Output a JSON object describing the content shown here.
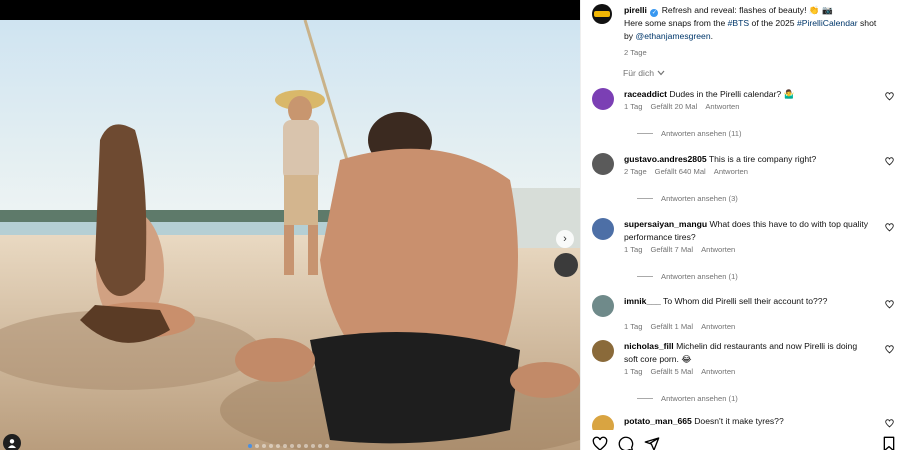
{
  "post": {
    "username": "pirelli",
    "caption_line1": "Refresh and reveal: flashes of beauty! 👏 📷",
    "caption_line2_prefix": "Here some snaps from the ",
    "caption_tag1": "#BTS",
    "caption_mid": " of the 2025 ",
    "caption_tag2": "#PirelliCalendar",
    "caption_suffix": " shot",
    "caption_line3_prefix": "by ",
    "caption_mention": "@ethanjamesgreen",
    "caption_end": ".",
    "time": "2 Tage"
  },
  "sort_label": "Für dich",
  "comments": [
    {
      "username": "raceaddict",
      "text": "Dudes in the Pirelli calendar? 🤷‍♂️",
      "time": "1 Tag",
      "likes": "Gefällt 20 Mal",
      "reply": "Antworten",
      "replies": "Antworten ansehen (11)",
      "avatar_color": "#7b3fb4"
    },
    {
      "username": "gustavo.andres2805",
      "text": "This is a tire company right?",
      "time": "2 Tage",
      "likes": "Gefällt 640 Mal",
      "reply": "Antworten",
      "replies": "Antworten ansehen (3)",
      "avatar_color": "#5a5a5a"
    },
    {
      "username": "supersaiyan_mangu",
      "text": "What does this have to do with top quality performance tires?",
      "time": "1 Tag",
      "likes": "Gefällt 7 Mal",
      "reply": "Antworten",
      "replies": "Antworten ansehen (1)",
      "avatar_color": "#4d6fa6"
    },
    {
      "username": "imnik___",
      "text": "To Whom did Pirelli sell their account to???",
      "time": "1 Tag",
      "likes": "Gefällt 1 Mal",
      "reply": "Antworten",
      "replies": "",
      "avatar_color": "#6f8a8a"
    },
    {
      "username": "nicholas_fill",
      "text": "Michelin did restaurants and now Pirelli is doing soft core porn. 😂",
      "time": "1 Tag",
      "likes": "Gefällt 5 Mal",
      "reply": "Antworten",
      "replies": "Antworten ansehen (1)",
      "avatar_color": "#8a6a3a"
    },
    {
      "username": "potato_man_665",
      "text": "Doesn't it make tyres??",
      "time": "",
      "likes": "",
      "reply": "",
      "replies": "",
      "avatar_color": "#d9a441"
    }
  ],
  "icons": {
    "heart": "heart-icon",
    "comment": "comment-icon",
    "share": "share-icon",
    "save": "bookmark-icon",
    "next": "chevron-right-icon",
    "user_tag": "user-icon"
  },
  "carousel": {
    "count": 12,
    "active_index": 0
  }
}
